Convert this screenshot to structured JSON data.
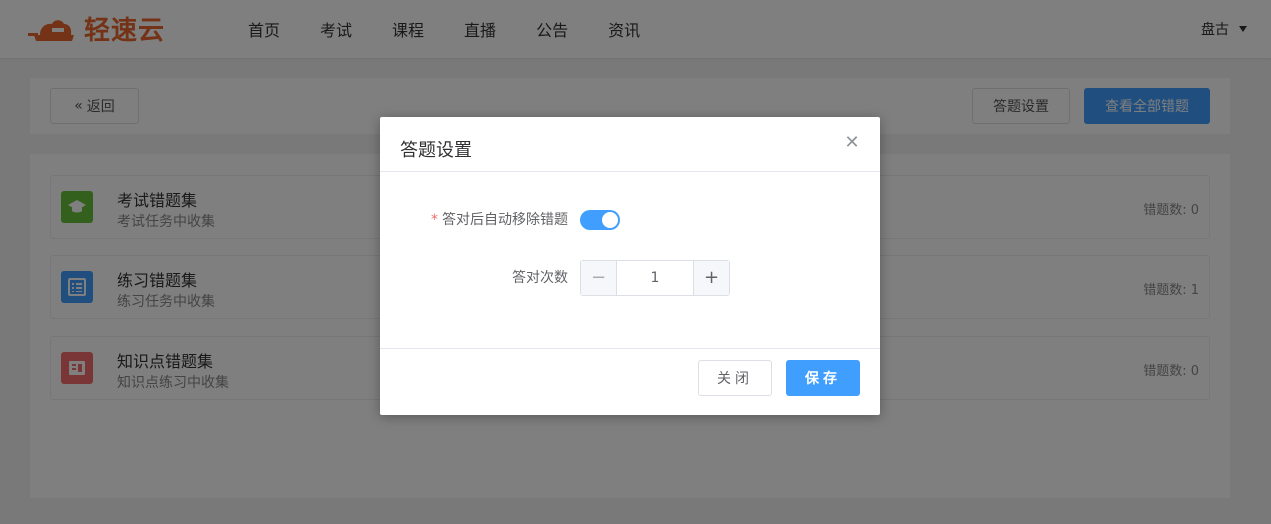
{
  "header": {
    "logo_text": "轻速云",
    "nav": [
      "首页",
      "考试",
      "课程",
      "直播",
      "公告",
      "资讯"
    ],
    "user": "盘古"
  },
  "toolbar": {
    "back_label": "返回",
    "settings_label": "答题设置",
    "view_all_label": "查看全部错题"
  },
  "cards": [
    {
      "title": "考试错题集",
      "subtitle": "考试任务中收集",
      "count": "错题数: 0",
      "icon": "graduation-cap-icon",
      "color": "#67c23a"
    },
    {
      "title": "练习错题集",
      "subtitle": "练习任务中收集",
      "count": "错题数: 1",
      "icon": "list-icon",
      "color": "#409eff"
    },
    {
      "title": "知识点错题集",
      "subtitle": "知识点练习中收集",
      "count": "错题数: 0",
      "icon": "book-icon",
      "color": "#f56c6c"
    }
  ],
  "dialog": {
    "title": "答题设置",
    "auto_remove_label": "答对后自动移除错题",
    "auto_remove_on": true,
    "times_label": "答对次数",
    "times_value": "1",
    "close_label": "关闭",
    "save_label": "保存"
  },
  "colors": {
    "primary": "#409eff",
    "brand": "#e8642c"
  }
}
